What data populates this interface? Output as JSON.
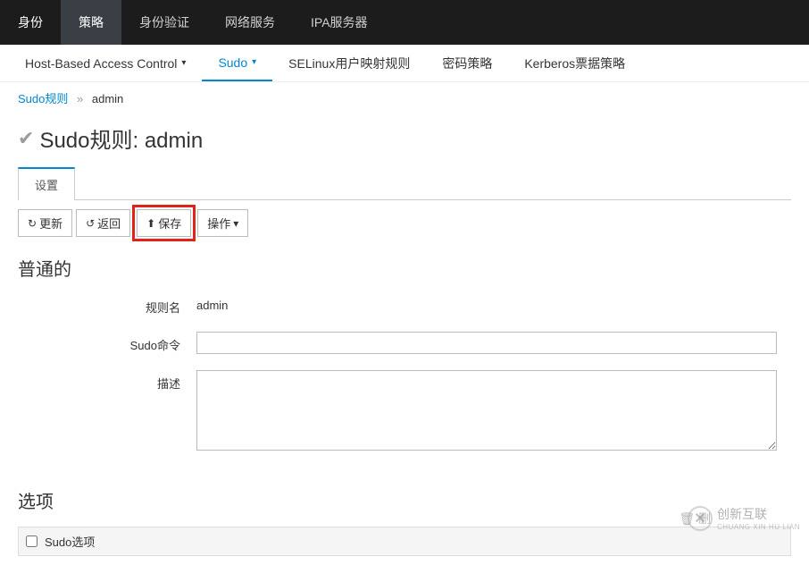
{
  "topnav": {
    "items": [
      "身份",
      "策略",
      "身份验证",
      "网络服务",
      "IPA服务器"
    ]
  },
  "subnav": {
    "items": [
      {
        "label": "Host-Based Access Control",
        "dropdown": true
      },
      {
        "label": "Sudo",
        "dropdown": true,
        "active": true
      },
      {
        "label": "SELinux用户映射规则"
      },
      {
        "label": "密码策略"
      },
      {
        "label": "Kerberos票据策略"
      }
    ]
  },
  "breadcrumb": {
    "root": "Sudo规则",
    "current": "admin"
  },
  "page_title_prefix": "Sudo规则:",
  "page_title_value": "admin",
  "tabs": [
    "设置"
  ],
  "buttons": {
    "refresh": "更新",
    "back": "返回",
    "save": "保存",
    "actions": "操作"
  },
  "sections": {
    "general": {
      "heading": "普通的",
      "fields": {
        "rule_name": {
          "label": "规则名",
          "value": "admin"
        },
        "sudo_cmd": {
          "label": "Sudo命令",
          "value": ""
        },
        "description": {
          "label": "描述",
          "value": ""
        }
      }
    },
    "options": {
      "heading": "选项",
      "table_header": "Sudo选项"
    }
  },
  "watermark": {
    "brand": "创新互联",
    "sub": "CHUANG XIN HU LIAN"
  }
}
